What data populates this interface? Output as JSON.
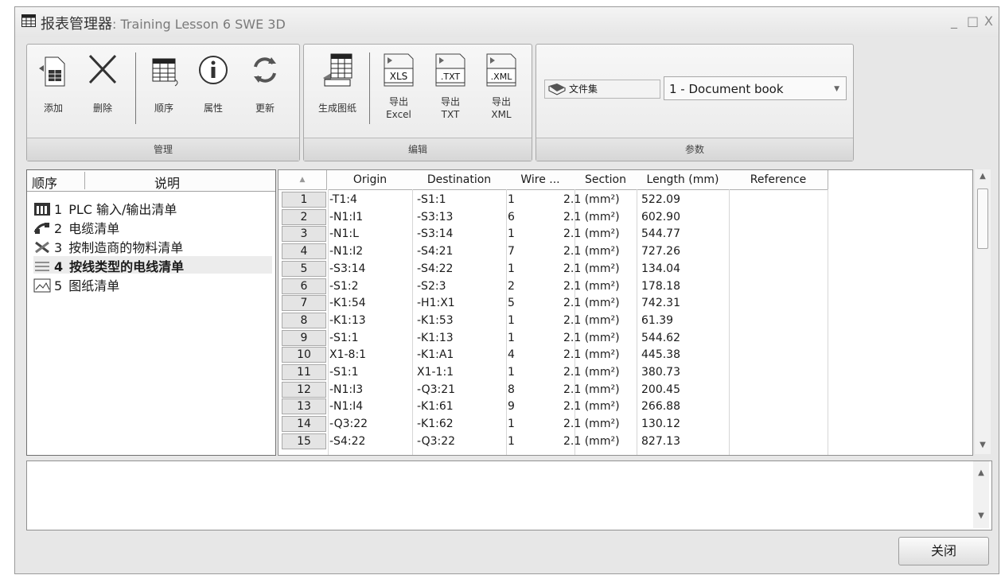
{
  "window": {
    "title": "报表管理器",
    "subtitle": ": Training Lesson 6 SWE 3D",
    "minimize": "_",
    "maximize": "□",
    "close": "X"
  },
  "ribbon": {
    "groups": {
      "manage": "管理",
      "edit": "编辑",
      "params": "参数"
    },
    "buttons": {
      "add": "添加",
      "delete": "删除",
      "order": "顺序",
      "properties": "属性",
      "update": "更新",
      "generate": "生成图纸",
      "export_xls_line1": "导出",
      "export_xls_line2": "Excel",
      "export_txt_line1": "导出",
      "export_txt_line2": "TXT",
      "export_xml_line1": "导出",
      "export_xml_line2": "XML",
      "xls_tag": "XLS",
      "txt_tag": ".TXT",
      "xml_tag": ".XML"
    },
    "param_label": "文件集",
    "param_value": "1 - Document book"
  },
  "reports": {
    "header_order": "顺序",
    "header_desc": "说明",
    "items": [
      {
        "num": "1",
        "label": "PLC 输入/输出清单",
        "icon": "plc-icon"
      },
      {
        "num": "2",
        "label": "电缆清单",
        "icon": "cable-icon"
      },
      {
        "num": "3",
        "label": "按制造商的物料清单",
        "icon": "tools-icon"
      },
      {
        "num": "4",
        "label": "按线类型的电线清单",
        "icon": "wire-list-icon"
      },
      {
        "num": "5",
        "label": "图纸清单",
        "icon": "drawing-icon"
      }
    ],
    "selected_index": 3
  },
  "grid": {
    "columns": [
      "Origin",
      "Destination",
      "Wire ...",
      "Section",
      "Length (mm)",
      "Reference"
    ],
    "sort_glyph": "▲",
    "rows": [
      {
        "n": "1",
        "origin": "-T1:4",
        "dest": "-S1:1",
        "wire": "1",
        "section": "2.1 (mm²)",
        "length": "522.09"
      },
      {
        "n": "2",
        "origin": "-N1:I1",
        "dest": "-S3:13",
        "wire": "6",
        "section": "2.1 (mm²)",
        "length": "602.90"
      },
      {
        "n": "3",
        "origin": "-N1:L",
        "dest": "-S3:14",
        "wire": "1",
        "section": "2.1 (mm²)",
        "length": "544.77"
      },
      {
        "n": "4",
        "origin": "-N1:I2",
        "dest": "-S4:21",
        "wire": "7",
        "section": "2.1 (mm²)",
        "length": "727.26"
      },
      {
        "n": "5",
        "origin": "-S3:14",
        "dest": "-S4:22",
        "wire": "1",
        "section": "2.1 (mm²)",
        "length": "134.04"
      },
      {
        "n": "6",
        "origin": "-S1:2",
        "dest": "-S2:3",
        "wire": "2",
        "section": "2.1 (mm²)",
        "length": "178.18"
      },
      {
        "n": "7",
        "origin": "-K1:54",
        "dest": "-H1:X1",
        "wire": "5",
        "section": "2.1 (mm²)",
        "length": "742.31"
      },
      {
        "n": "8",
        "origin": "-K1:13",
        "dest": "-K1:53",
        "wire": "1",
        "section": "2.1 (mm²)",
        "length": "61.39"
      },
      {
        "n": "9",
        "origin": "-S1:1",
        "dest": "-K1:13",
        "wire": "1",
        "section": "2.1 (mm²)",
        "length": "544.62"
      },
      {
        "n": "10",
        "origin": "X1-8:1",
        "dest": "-K1:A1",
        "wire": "4",
        "section": "2.1 (mm²)",
        "length": "445.38"
      },
      {
        "n": "11",
        "origin": "-S1:1",
        "dest": "X1-1:1",
        "wire": "1",
        "section": "2.1 (mm²)",
        "length": "380.73"
      },
      {
        "n": "12",
        "origin": "-N1:I3",
        "dest": "-Q3:21",
        "wire": "8",
        "section": "2.1 (mm²)",
        "length": "200.45"
      },
      {
        "n": "13",
        "origin": "-N1:I4",
        "dest": "-K1:61",
        "wire": "9",
        "section": "2.1 (mm²)",
        "length": "266.88"
      },
      {
        "n": "14",
        "origin": "-Q3:22",
        "dest": "-K1:62",
        "wire": "1",
        "section": "2.1 (mm²)",
        "length": "130.12"
      },
      {
        "n": "15",
        "origin": "-S4:22",
        "dest": "-Q3:22",
        "wire": "1",
        "section": "2.1 (mm²)",
        "length": "827.13"
      }
    ]
  },
  "footer": {
    "close_label": "关闭"
  }
}
